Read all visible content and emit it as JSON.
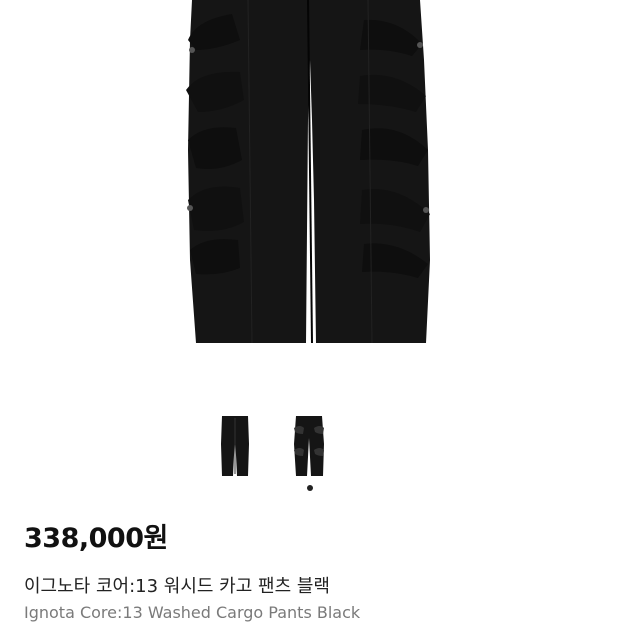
{
  "product": {
    "price": "338,000원",
    "name_korean": "이그노타 코어:13 워시드 카고 팬츠 블랙",
    "name_english": "Ignota Core:13 Washed Cargo Pants Black"
  },
  "gallery": {
    "main_image": "black-cargo-pants-photo",
    "thumbnails": [
      "black-cargo-pants-front-thumb",
      "black-cargo-pants-side-thumb"
    ],
    "active_index": 2,
    "total": 2
  },
  "colors": {
    "product": "#151515",
    "background": "#ffffff",
    "price_text": "#111111",
    "secondary_text": "#7a7a7a"
  }
}
